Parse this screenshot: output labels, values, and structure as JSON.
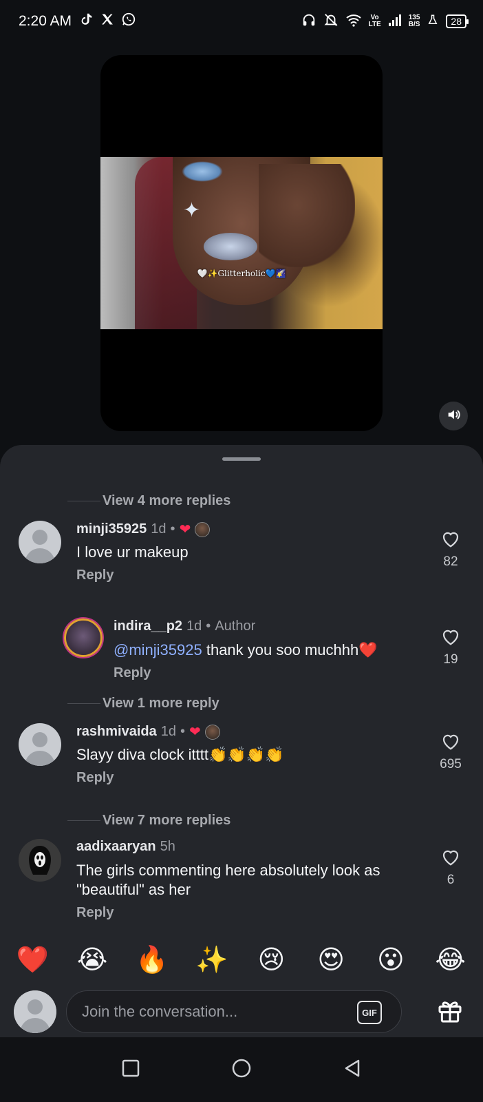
{
  "status_bar": {
    "time": "2:20 AM",
    "app_icons": [
      "tiktok-icon",
      "x-icon",
      "whatsapp-icon"
    ],
    "network_label_top": "Vo",
    "network_label_bottom": "LTE",
    "speed_top": "135",
    "speed_bottom": "B/S",
    "battery": "28"
  },
  "video": {
    "caption": "🤍✨Glitterholic💙🌠"
  },
  "comments": {
    "view_more_top": "View 4 more replies",
    "items": [
      {
        "username": "minji35925",
        "age": "1d",
        "separator": "•",
        "text": "I love ur makeup",
        "reply_label": "Reply",
        "likes": "82"
      },
      {
        "username": "indira__p2",
        "age": "1d",
        "separator": "•",
        "badge": "Author",
        "mention": "@minji35925",
        "text": " thank you soo muchhh❤️",
        "reply_label": "Reply",
        "likes": "19"
      },
      {
        "username": "rashmivaida",
        "age": "1d",
        "separator": "•",
        "text": "Slayy diva clock itttt👏👏👏👏",
        "reply_label": "Reply",
        "likes": "695"
      },
      {
        "username": "aadixaaryan",
        "age": "5h",
        "text_line1": "The girls commenting here absolutely look as",
        "text_line2": "\"beautiful\" as her",
        "reply_label": "Reply",
        "likes": "6"
      }
    ],
    "view_more_1": "View 1 more reply",
    "view_more_7": "View 7 more replies"
  },
  "emoji_bar": [
    "❤️",
    "😭",
    "🔥",
    "✨",
    "😢",
    "😍",
    "😮",
    "😂"
  ],
  "composer": {
    "placeholder": "Join the conversation...",
    "gif_label": "GIF"
  },
  "colors": {
    "sheet_bg": "#24262b",
    "accent_heart": "#fe2c55",
    "mention": "#8fb0ff"
  }
}
